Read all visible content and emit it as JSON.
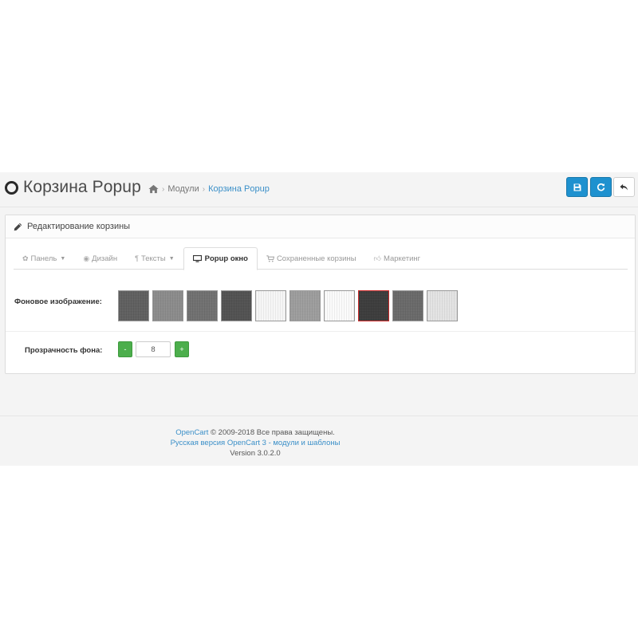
{
  "header": {
    "title": "Корзина Popup",
    "breadcrumb": [
      "Модули",
      "Корзина Popup"
    ],
    "buttons": {
      "save": "save-icon",
      "refresh": "refresh-icon",
      "back": "reply-icon"
    }
  },
  "panel": {
    "heading": "Редактирование корзины",
    "tabs": [
      {
        "label": "Панель",
        "icon": "cog-icon",
        "dropdown": true,
        "active": false
      },
      {
        "label": "Дизайн",
        "icon": "eye-icon",
        "dropdown": false,
        "active": false
      },
      {
        "label": "Тексты",
        "icon": "text-icon",
        "dropdown": true,
        "active": false
      },
      {
        "label": "Popup окно",
        "icon": "desktop-icon",
        "dropdown": false,
        "active": true
      },
      {
        "label": "Сохраненные корзины",
        "icon": "cart-icon",
        "dropdown": false,
        "active": false
      },
      {
        "label": "Маркетинг",
        "icon": "thumbs-up-icon",
        "dropdown": false,
        "active": false
      }
    ],
    "background": {
      "label": "Фоновое изображение:",
      "swatches": [
        "#5e5e5e",
        "#8a8a8a",
        "#6f6f6f",
        "#505050",
        "#f6f6f6",
        "#9c9c9c",
        "#fbfbfb",
        "#3a3a3a",
        "#686868",
        "#e3e3e3"
      ],
      "selected_index": 7,
      "selected_border_color": "#cc2a2a"
    },
    "opacity": {
      "label": "Прозрачность фона:",
      "minus": "-",
      "plus": "+",
      "value": "8"
    }
  },
  "footer": {
    "brand": "OpenCart",
    "copyright": "© 2009-2018 Все права защищены.",
    "russian_link": "Русская версия OpenCart 3 - модули и шаблоны",
    "version": "Version 3.0.2.0"
  },
  "colors": {
    "primary": "#1e91cf",
    "success": "#4cae4c",
    "link": "#3a8fc8"
  }
}
